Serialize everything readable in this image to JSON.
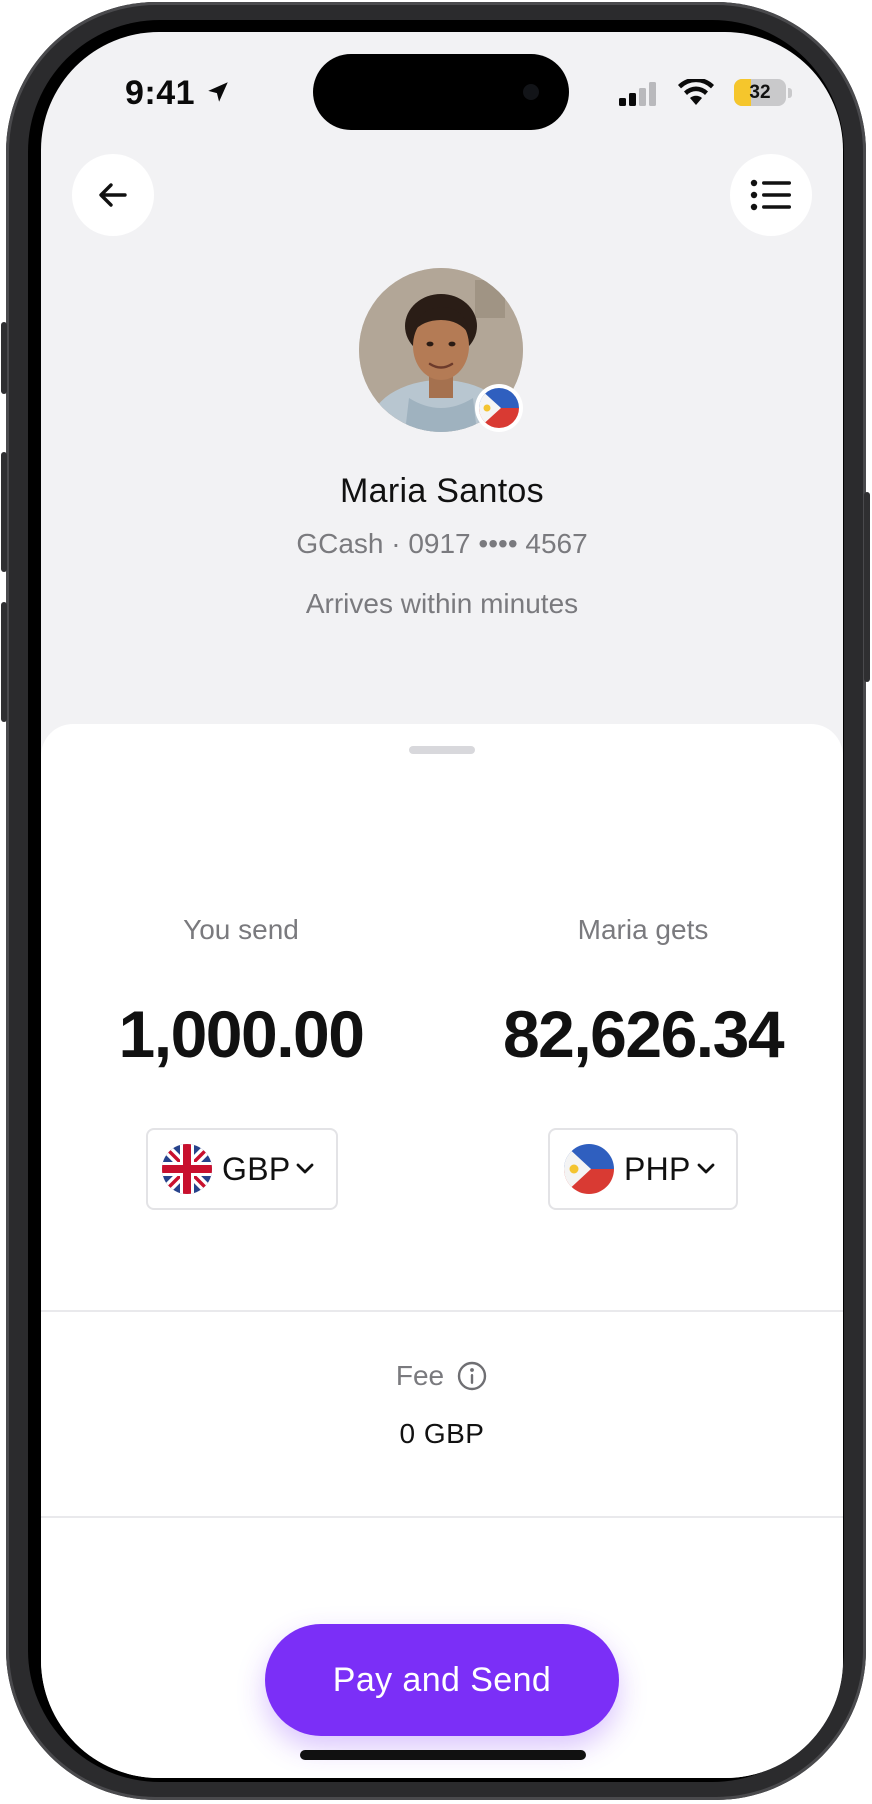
{
  "status_bar": {
    "time": "9:41",
    "battery_level": "32",
    "battery_fraction": 0.32,
    "signal_bars_active": 2,
    "signal_bars_total": 4
  },
  "nav": {
    "back_icon": "arrow-left-icon",
    "menu_icon": "list-icon"
  },
  "recipient": {
    "name": "Maria Santos",
    "account": "GCash · 0917 •••• 4567",
    "eta": "Arrives within minutes",
    "flag_icon": "philippines-flag-icon"
  },
  "send": {
    "label": "You send",
    "amount": "1,000.00",
    "currency": "GBP",
    "flag_icon": "uk-flag-icon"
  },
  "receive": {
    "label": "Maria gets",
    "amount": "82,626.34",
    "currency": "PHP",
    "flag_icon": "philippines-flag-icon"
  },
  "fee": {
    "label": "Fee",
    "value": "0 GBP"
  },
  "cta": {
    "label": "Pay and Send"
  },
  "colors": {
    "accent": "#7b2ff7",
    "background": "#f2f2f4",
    "sheet": "#ffffff",
    "muted_text": "#7a7a7e",
    "battery": "#f5c62c"
  }
}
